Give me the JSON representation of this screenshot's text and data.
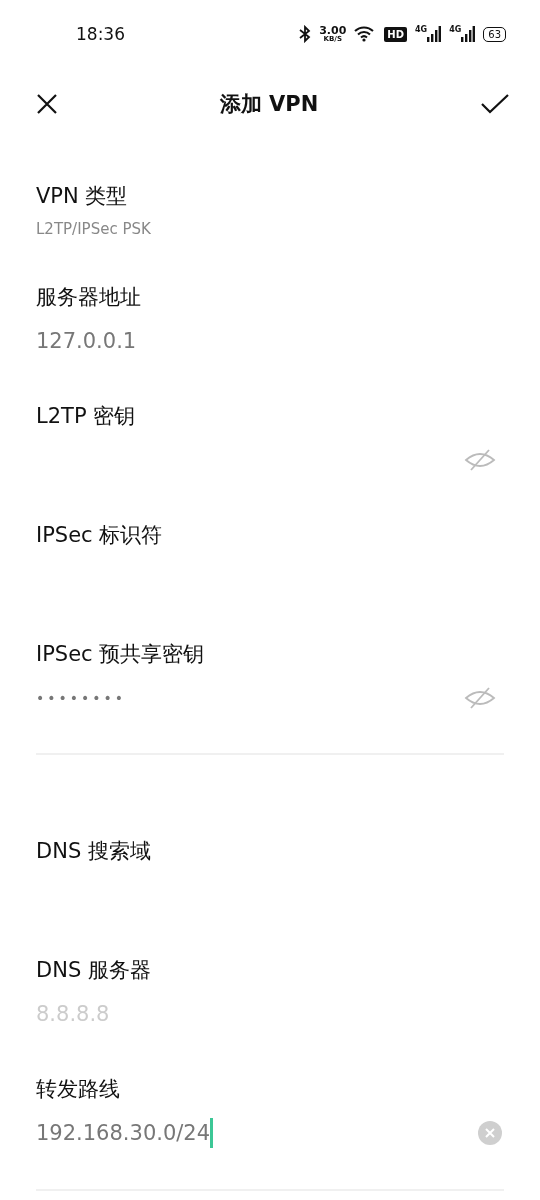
{
  "status_bar": {
    "time": "18:36",
    "speed": "3.00",
    "speed_unit": "KB/S",
    "hd": "HD",
    "networks": [
      "4G",
      "4G"
    ],
    "battery": "63"
  },
  "header": {
    "title": "添加 VPN"
  },
  "sections": [
    {
      "fields": [
        {
          "kind": "select",
          "label": "VPN 类型",
          "value": "L2TP/IPSec PSK"
        },
        {
          "kind": "text",
          "label": "服务器地址",
          "value": "127.0.0.1",
          "focused": false
        },
        {
          "kind": "password",
          "label": "L2TP 密钥",
          "focused": false
        },
        {
          "kind": "text",
          "label": "IPSec 标识符",
          "focused": false
        },
        {
          "kind": "password",
          "label": "IPSec 预共享密钥",
          "value": "••••••••",
          "focused": false
        }
      ]
    },
    {
      "fields": [
        {
          "kind": "text",
          "label": "DNS 搜索域",
          "focused": false
        },
        {
          "kind": "text",
          "label": "DNS 服务器",
          "placeholder": "8.8.8.8",
          "focused": false
        },
        {
          "kind": "text",
          "label": "转发路线",
          "value": "192.168.30.0/24",
          "focused": true
        }
      ]
    }
  ]
}
